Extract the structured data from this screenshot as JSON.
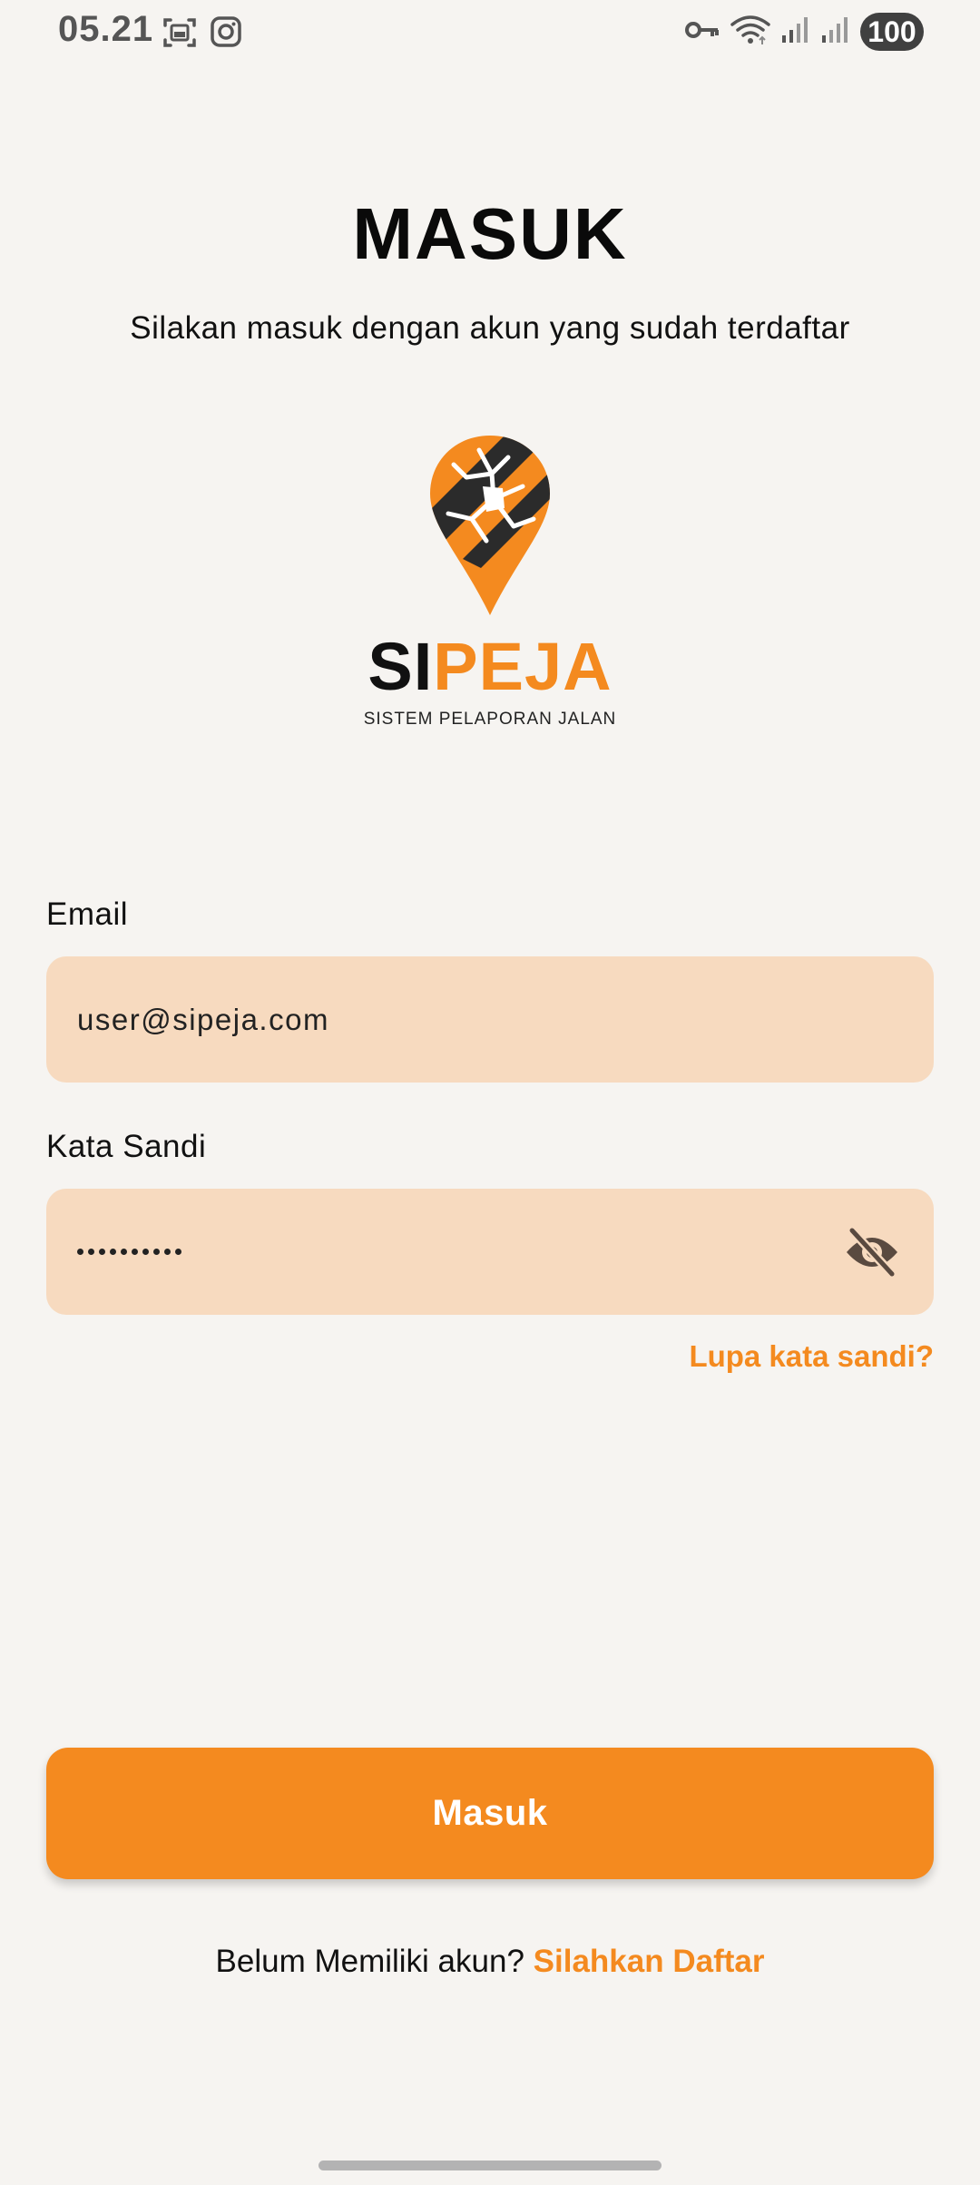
{
  "status_bar": {
    "time": "05.21",
    "battery": "100",
    "left_icons": [
      "screenshot-icon",
      "instagram-icon"
    ],
    "right_icons": [
      "vpn-key-icon",
      "wifi-icon",
      "signal-icon",
      "signal-icon"
    ]
  },
  "header": {
    "title": "MASUK",
    "subtitle": "Silakan masuk dengan akun yang sudah terdaftar"
  },
  "logo": {
    "wordmark_black": "SI",
    "wordmark_orange": "PEJA",
    "tagline": "SISTEM PELAPORAN JALAN"
  },
  "form": {
    "email_label": "Email",
    "email_value": "user@sipeja.com",
    "password_label": "Kata Sandi",
    "password_length": 10,
    "password_visibility": "hidden",
    "forgot_password": "Lupa kata sandi?",
    "submit_label": "Masuk"
  },
  "footer": {
    "prompt": "Belum Memiliki akun?",
    "register_link": "Silahkan Daftar"
  },
  "colors": {
    "accent": "#f48a1f",
    "field_background": "#f7dabf",
    "page_background": "#f6f4f1",
    "text": "#111111"
  }
}
